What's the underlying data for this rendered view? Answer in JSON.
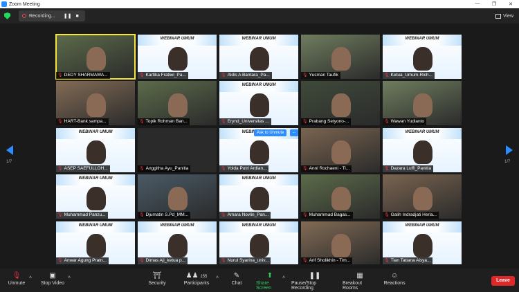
{
  "window": {
    "title": "Zoom Meeting"
  },
  "topbar": {
    "recording_label": "Recording...",
    "view_label": "View"
  },
  "gallery": {
    "page_left": "1/7",
    "page_right": "1/7",
    "webinar_title": "WEBINAR UMUM",
    "ask_to_unmute": "Ask to Unmute",
    "ask_more": "...",
    "tiles": [
      {
        "name": "DEDY SHARMAWA...",
        "kind": "camera"
      },
      {
        "name": "Kartika Fratiwi_Pa...",
        "kind": "webinar"
      },
      {
        "name": "Aldis A Bantara_Pa...",
        "kind": "webinar"
      },
      {
        "name": "Yusman Taufik",
        "kind": "camera"
      },
      {
        "name": "Ketua_Umum-Rich...",
        "kind": "webinar"
      },
      {
        "name": "HART-Bank sampa...",
        "kind": "camera"
      },
      {
        "name": "Topik Rohman Ban...",
        "kind": "camera"
      },
      {
        "name": "Erynd_Universitas ...",
        "kind": "webinar"
      },
      {
        "name": "Prabang Setyono-...",
        "kind": "camera"
      },
      {
        "name": "Wawan Yudianto",
        "kind": "camera"
      },
      {
        "name": "ASEP SAEFULLOH...",
        "kind": "webinar"
      },
      {
        "name": "Anggitha Ayu_Panitia",
        "kind": "dark"
      },
      {
        "name": "Yolda Putri Ardian...",
        "kind": "webinar"
      },
      {
        "name": "Anni Rochaeni - Ti...",
        "kind": "camera"
      },
      {
        "name": "Dazara Luffi_Panitia",
        "kind": "webinar"
      },
      {
        "name": "Muhammad Panzu...",
        "kind": "webinar"
      },
      {
        "name": "Djumatin S.Pd_MM...",
        "kind": "camera"
      },
      {
        "name": "Amara Novlin_Pan...",
        "kind": "webinar"
      },
      {
        "name": "Muhammad Bagas...",
        "kind": "camera"
      },
      {
        "name": "Galih Indradjati Herla...",
        "kind": "camera"
      },
      {
        "name": "Anwar Agung Pratn...",
        "kind": "webinar"
      },
      {
        "name": "Dimas Aji_ketua p...",
        "kind": "webinar"
      },
      {
        "name": "Nurul Syarina_univ...",
        "kind": "webinar"
      },
      {
        "name": "Arif Sholikhin - Tim...",
        "kind": "camera"
      },
      {
        "name": "Tian Tatiana Aisya...",
        "kind": "webinar"
      }
    ]
  },
  "toolbar": {
    "unmute": "Unmute",
    "stop_video": "Stop Video",
    "security": "Security",
    "participants": "Participants",
    "participants_count": "155",
    "chat": "Chat",
    "share_screen": "Share Screen",
    "recording": "Pause/Stop Recording",
    "breakout": "Breakout Rooms",
    "reactions": "Reactions",
    "leave": "Leave"
  },
  "colors": {
    "accent": "#2d8cff",
    "share": "#2ccb5b",
    "leave": "#e02828",
    "active_speaker": "#f5e63a"
  }
}
